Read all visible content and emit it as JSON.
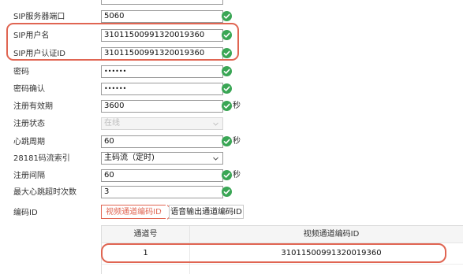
{
  "form": {
    "sip_server_port": {
      "label": "SIP服务器端口",
      "value": "5060"
    },
    "sip_username": {
      "label": "SIP用户名",
      "value": "31011500991320019360"
    },
    "sip_auth_id": {
      "label": "SIP用户认证ID",
      "value": "31011500991320019360"
    },
    "password": {
      "label": "密码",
      "value": "••••••"
    },
    "password_confirm": {
      "label": "密码确认",
      "value": "••••••"
    },
    "register_validity": {
      "label": "注册有效期",
      "value": "3600",
      "unit": "秒"
    },
    "register_status": {
      "label": "注册状态",
      "value": "在线"
    },
    "heartbeat_period": {
      "label": "心跳周期",
      "value": "60",
      "unit": "秒"
    },
    "stream_index_28181": {
      "label": "28181码流索引",
      "value": "主码流（定时)"
    },
    "register_interval": {
      "label": "注册间隔",
      "value": "60",
      "unit": "秒"
    },
    "max_heartbeat_timeouts": {
      "label": "最大心跳超时次数",
      "value": "3"
    },
    "encoding_id": {
      "label": "编码ID"
    }
  },
  "tabs": [
    {
      "label": "视频通道编码ID",
      "active": true
    },
    {
      "label": "语音输出通道编码ID",
      "active": false
    }
  ],
  "table": {
    "headers": [
      "通道号",
      "视频通道编码ID"
    ],
    "rows": [
      [
        "1",
        "31011500991320019360"
      ]
    ]
  },
  "colors": {
    "accent": "#e06552",
    "ok_green": "#3aa655"
  },
  "icons": {
    "validation": "check-circle-icon",
    "dropdown": "chevron-down-icon"
  }
}
